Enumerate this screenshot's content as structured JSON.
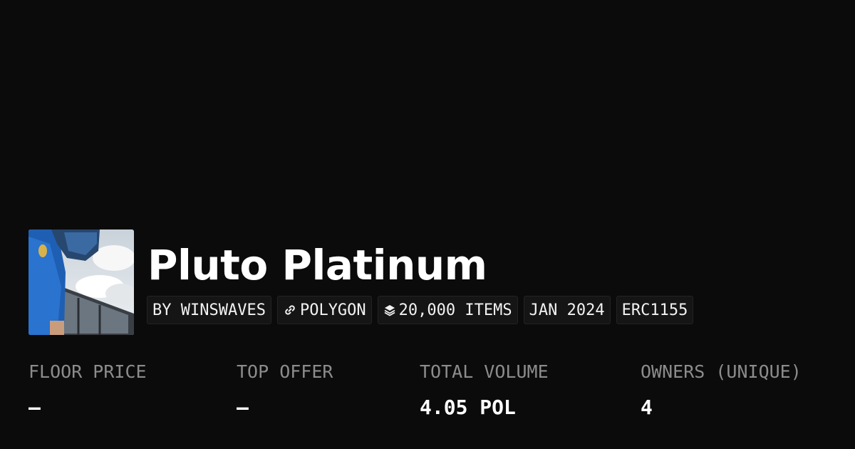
{
  "collection": {
    "name": "Pluto Platinum",
    "avatar_icon": "collection-photo"
  },
  "tags": {
    "creator": "BY WINSWAVES",
    "chain": "POLYGON",
    "chain_icon": "polygon-link-icon",
    "items": "20,000 ITEMS",
    "items_icon": "layers-icon",
    "date": "JAN 2024",
    "standard": "ERC1155"
  },
  "stats": [
    {
      "label": "FLOOR PRICE",
      "value": "–"
    },
    {
      "label": "TOP OFFER",
      "value": "–"
    },
    {
      "label": "TOTAL VOLUME",
      "value": "4.05 POL"
    },
    {
      "label": "OWNERS (UNIQUE)",
      "value": "4"
    }
  ],
  "colors": {
    "background": "#0b0b0b",
    "tag_background": "#151515",
    "label": "#8c8c8c",
    "text": "#ffffff"
  }
}
